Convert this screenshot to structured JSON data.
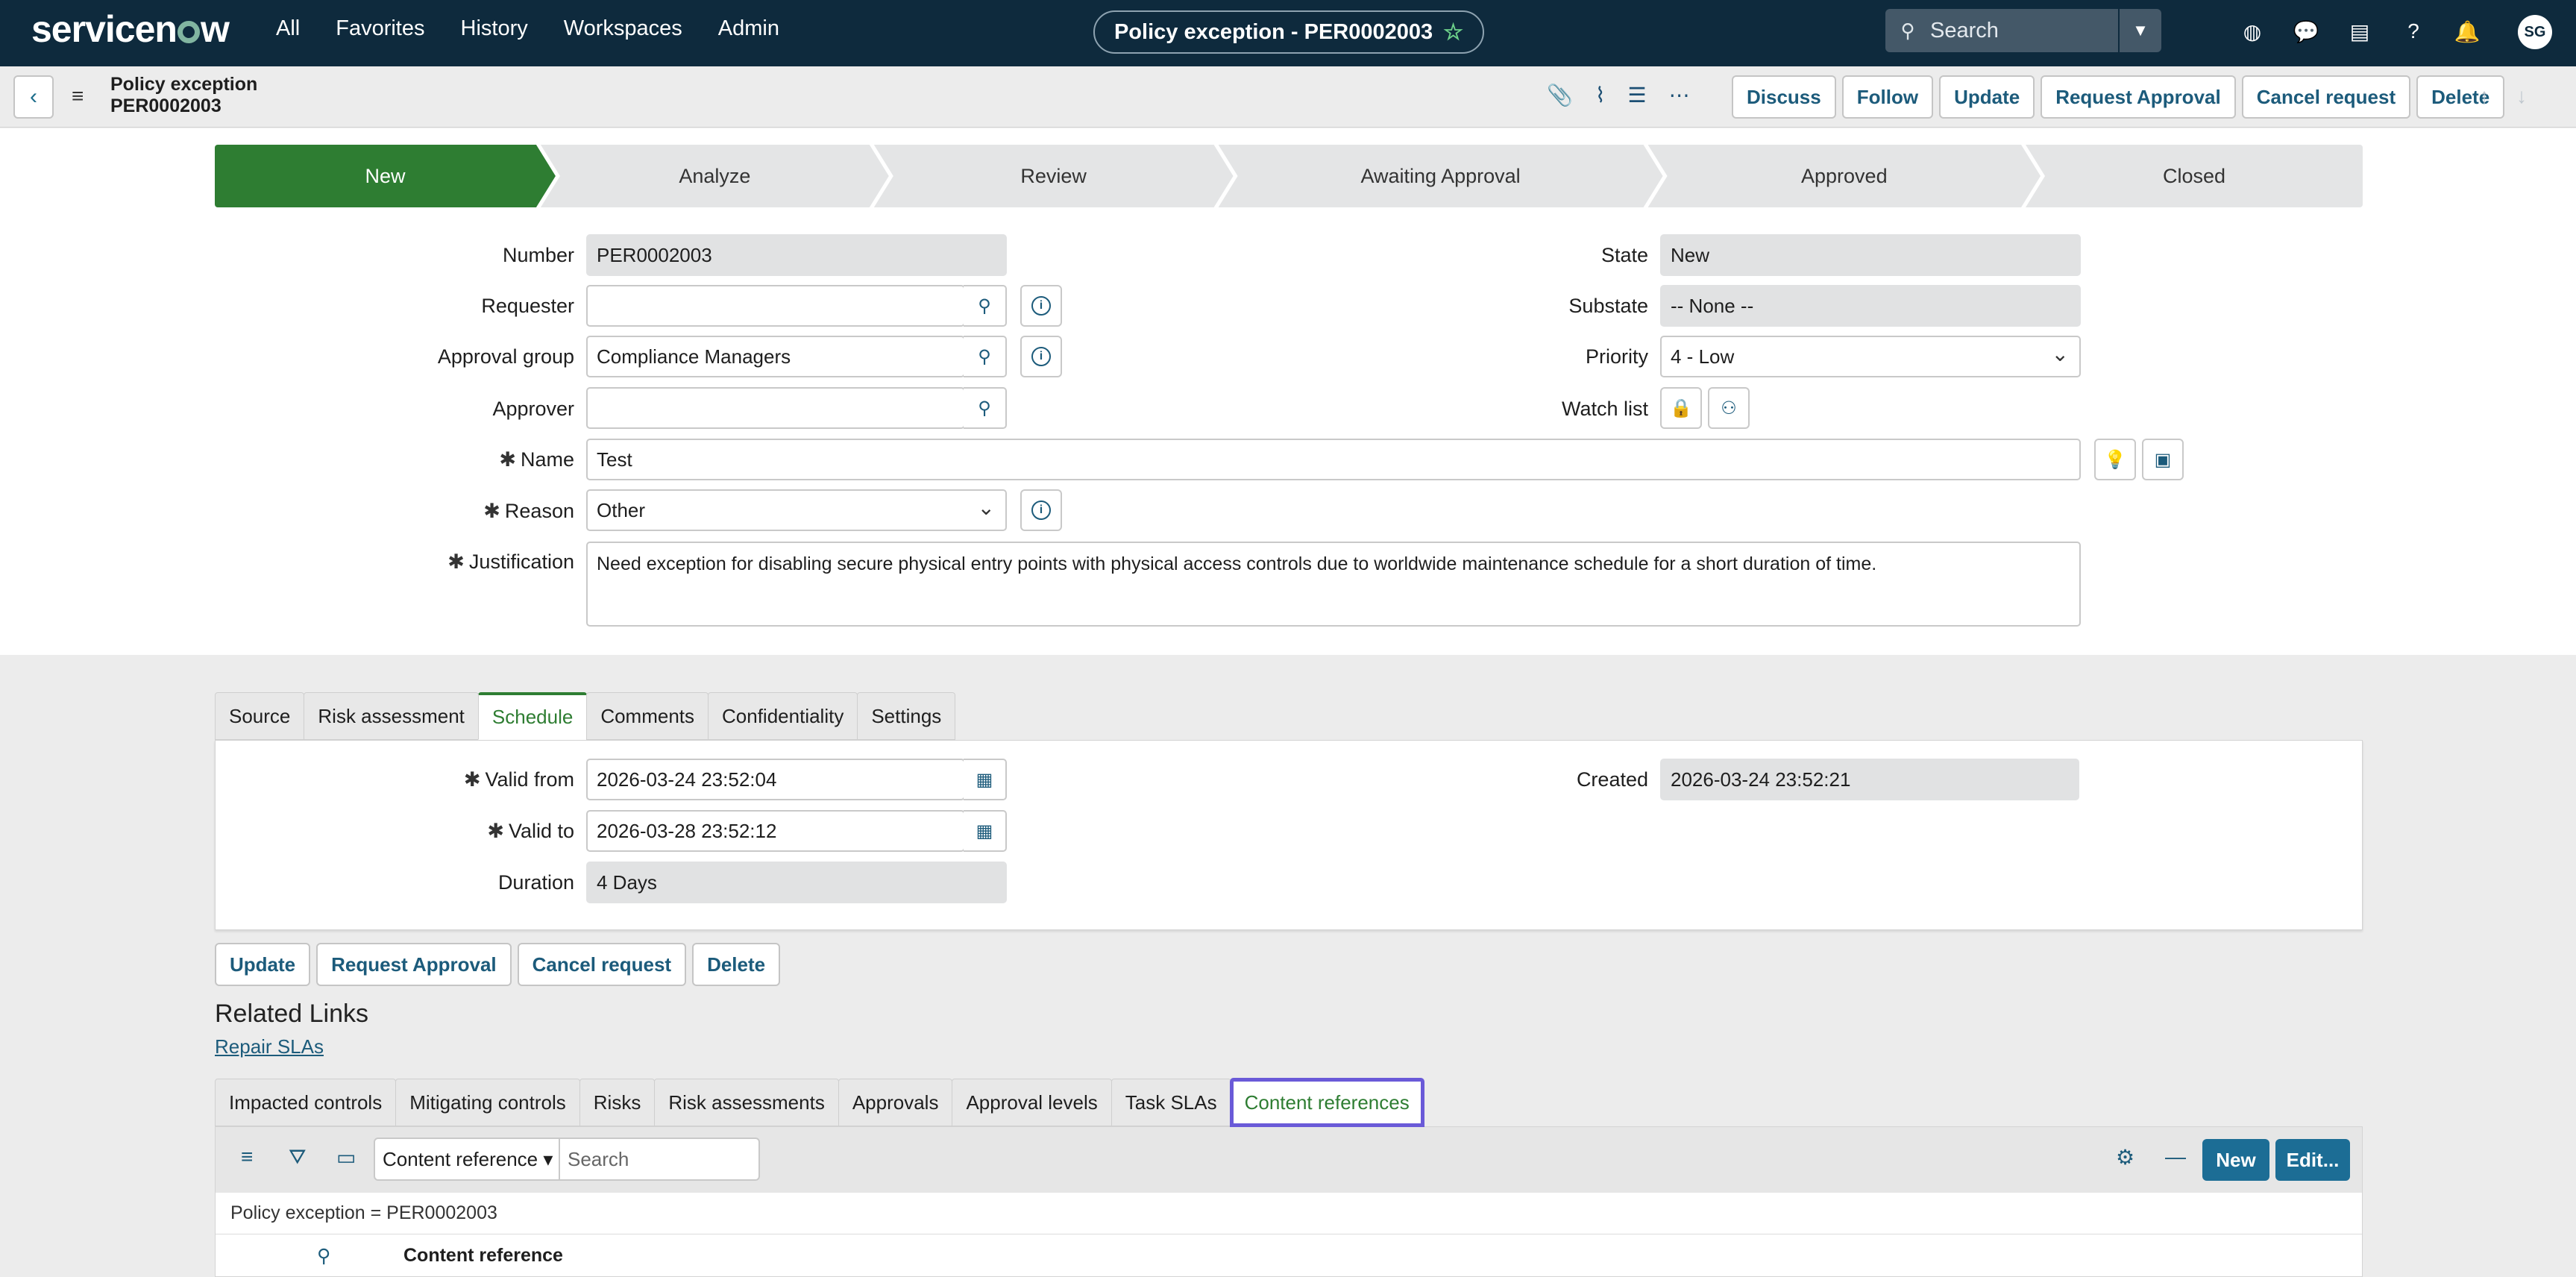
{
  "nav": {
    "logo": "servicenow",
    "links": [
      "All",
      "Favorites",
      "History",
      "Workspaces",
      "Admin"
    ],
    "record_pill": "Policy exception - PER0002003",
    "search_placeholder": "Search",
    "avatar": "SG"
  },
  "header": {
    "title_line1": "Policy exception",
    "title_line2": "PER0002003",
    "buttons": [
      "Discuss",
      "Follow",
      "Update",
      "Request Approval",
      "Cancel request",
      "Delete"
    ]
  },
  "stages": [
    "New",
    "Analyze",
    "Review",
    "Awaiting Approval",
    "Approved",
    "Closed"
  ],
  "active_stage": "New",
  "form": {
    "number_label": "Number",
    "number": "PER0002003",
    "requester_label": "Requester",
    "requester": "",
    "approval_group_label": "Approval group",
    "approval_group": "Compliance Managers",
    "approver_label": "Approver",
    "approver": "",
    "name_label": "Name",
    "name": "Test",
    "reason_label": "Reason",
    "reason": "Other",
    "justification_label": "Justification",
    "justification": "Need exception for disabling secure physical entry points with physical access controls due to worldwide maintenance schedule for a short duration of time.",
    "state_label": "State",
    "state": "New",
    "substate_label": "Substate",
    "substate": "-- None --",
    "priority_label": "Priority",
    "priority": "4 - Low",
    "watchlist_label": "Watch list"
  },
  "tabs": [
    "Source",
    "Risk assessment",
    "Schedule",
    "Comments",
    "Confidentiality",
    "Settings"
  ],
  "active_tab": "Schedule",
  "schedule": {
    "valid_from_label": "Valid from",
    "valid_from": "2026-03-24 23:52:04",
    "valid_to_label": "Valid to",
    "valid_to": "2026-03-28 23:52:12",
    "duration_label": "Duration",
    "duration": "4 Days",
    "created_label": "Created",
    "created": "2026-03-24 23:52:21"
  },
  "bottom_buttons": [
    "Update",
    "Request Approval",
    "Cancel request",
    "Delete"
  ],
  "related": {
    "title": "Related Links",
    "link": "Repair SLAs",
    "tabs": [
      "Impacted controls",
      "Mitigating controls",
      "Risks",
      "Risk assessments",
      "Approvals",
      "Approval levels",
      "Task SLAs",
      "Content references"
    ],
    "focused_tab": "Content references",
    "list_selector": "Content reference",
    "list_search_placeholder": "Search",
    "new_button": "New",
    "edit_button": "Edit...",
    "filter": "Policy exception = PER0002003",
    "column": "Content reference"
  },
  "colors": {
    "nav_bg": "#0e2a3d",
    "active_stage": "#2e7d32",
    "accent": "#1c6d95",
    "focus": "#6a5ad8"
  }
}
